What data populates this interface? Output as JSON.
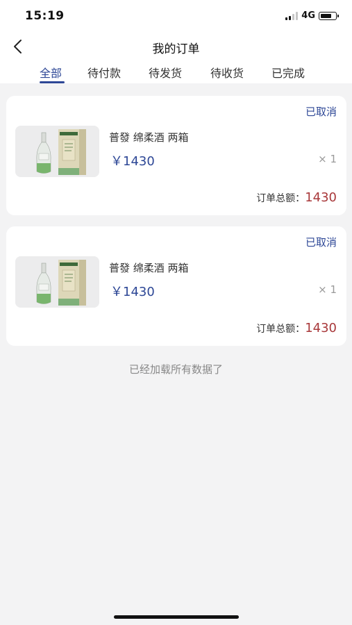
{
  "status_bar": {
    "time": "15:19",
    "network": "4G"
  },
  "header": {
    "title": "我的订单"
  },
  "tabs": [
    {
      "label": "全部",
      "active": true
    },
    {
      "label": "待付款",
      "active": false
    },
    {
      "label": "待发货",
      "active": false
    },
    {
      "label": "待收货",
      "active": false
    },
    {
      "label": "已完成",
      "active": false
    }
  ],
  "orders": [
    {
      "status": "已取消",
      "product_name": "普發 绵柔酒 两箱",
      "price": "￥1430",
      "quantity": "× 1",
      "total_label": "订单总额：",
      "total_value": "1430"
    },
    {
      "status": "已取消",
      "product_name": "普發 绵柔酒 两箱",
      "price": "￥1430",
      "quantity": "× 1",
      "total_label": "订单总额：",
      "total_value": "1430"
    }
  ],
  "footer_note": "已经加载所有数据了",
  "colors": {
    "accent": "#2d4796",
    "total": "#a8383a",
    "background": "#f3f3f4"
  },
  "icons": {
    "back": "chevron-left-icon",
    "signal": "cellular-signal-icon",
    "battery": "battery-icon"
  }
}
